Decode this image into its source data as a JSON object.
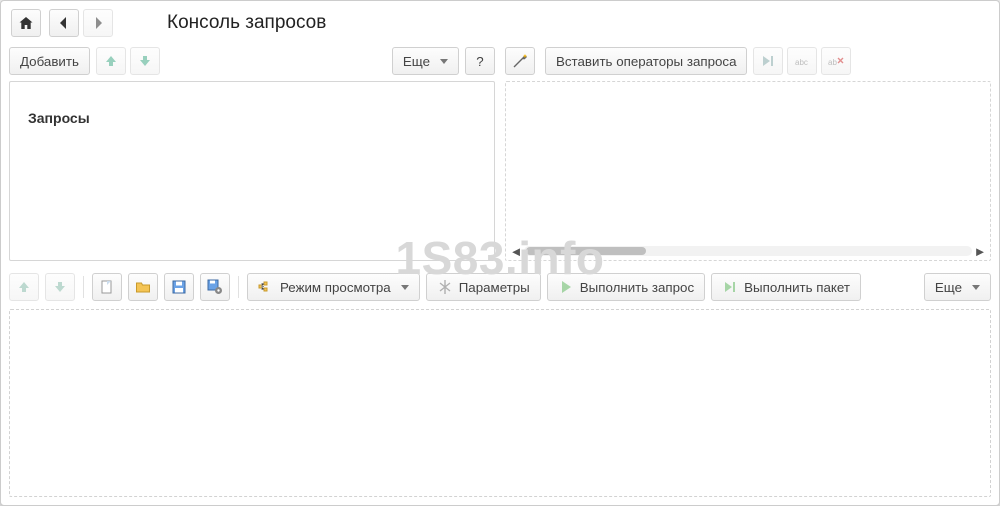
{
  "header": {
    "title": "Консоль запросов"
  },
  "left_toolbar": {
    "add_label": "Добавить",
    "more_label": "Еще",
    "help_label": "?"
  },
  "right_toolbar": {
    "insert_operators_label": "Вставить операторы запроса"
  },
  "tree": {
    "root_label": "Запросы"
  },
  "mid_toolbar": {
    "view_mode_label": "Режим просмотра",
    "parameters_label": "Параметры",
    "execute_query_label": "Выполнить запрос",
    "execute_batch_label": "Выполнить пакет",
    "more_label": "Еще"
  },
  "watermark": "1S83.info"
}
